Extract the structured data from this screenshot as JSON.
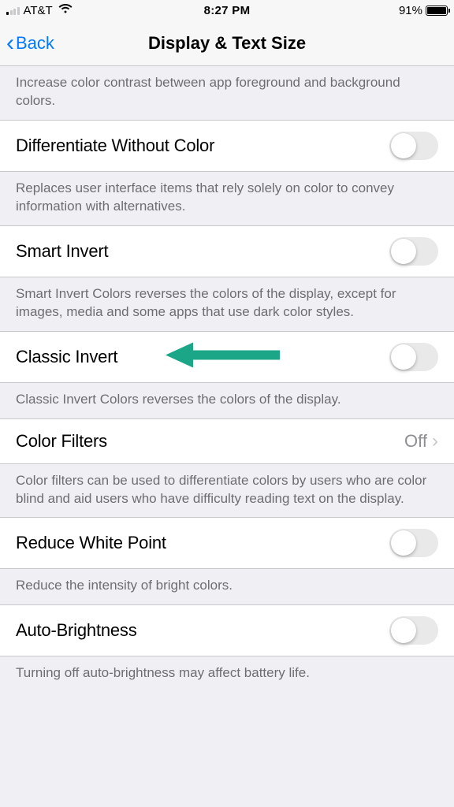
{
  "statusBar": {
    "carrier": "AT&T",
    "time": "8:27 PM",
    "batteryPct": "91%"
  },
  "nav": {
    "back": "Back",
    "title": "Display & Text Size"
  },
  "sections": {
    "contrastFooter": "Increase color contrast between app foreground and background colors.",
    "differentiate": {
      "label": "Differentiate Without Color",
      "footer": "Replaces user interface items that rely solely on color to convey information with alternatives."
    },
    "smartInvert": {
      "label": "Smart Invert",
      "footer": "Smart Invert Colors reverses the colors of the display, except for images, media and some apps that use dark color styles."
    },
    "classicInvert": {
      "label": "Classic Invert",
      "footer": "Classic Invert Colors reverses the colors of the display."
    },
    "colorFilters": {
      "label": "Color Filters",
      "value": "Off",
      "footer": "Color filters can be used to differentiate colors by users who are color blind and aid users who have difficulty reading text on the display."
    },
    "reduceWhite": {
      "label": "Reduce White Point",
      "footer": "Reduce the intensity of bright colors."
    },
    "autoBrightness": {
      "label": "Auto-Brightness",
      "footer": "Turning off auto-brightness may affect battery life."
    }
  }
}
